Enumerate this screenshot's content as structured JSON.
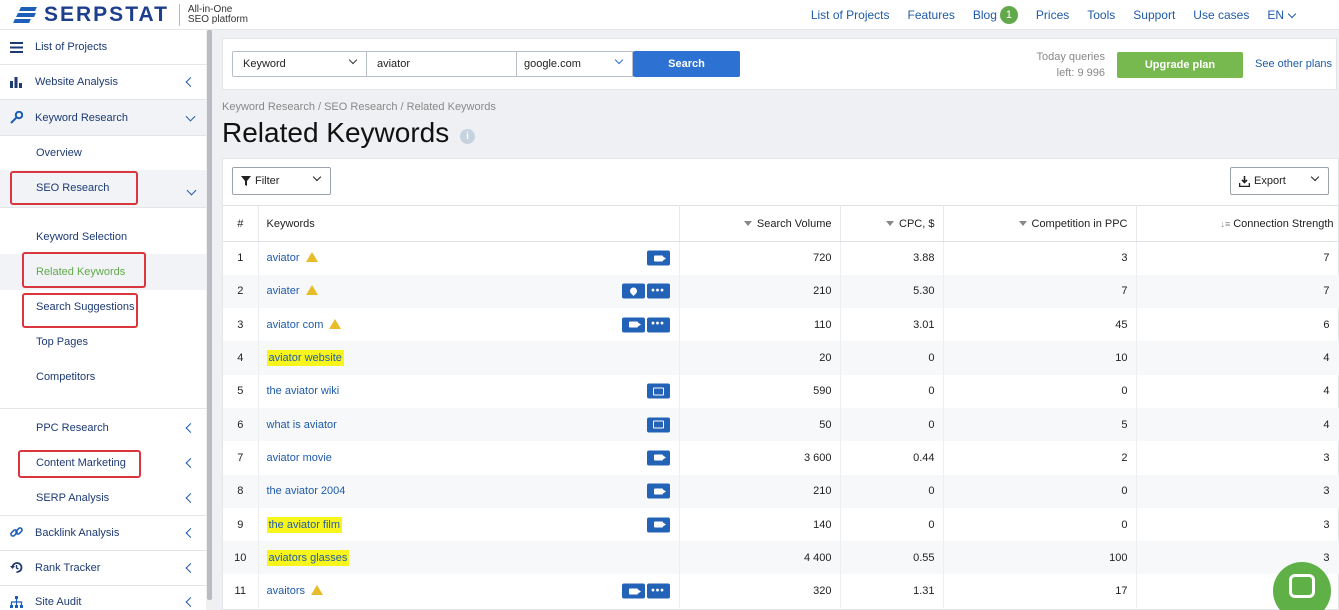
{
  "header": {
    "logo_text": "SERPSTAT",
    "tagline_line1": "All-in-One",
    "tagline_line2": "SEO platform",
    "nav": [
      "List of Projects",
      "Features",
      "Blog",
      "Prices",
      "Tools",
      "Support",
      "Use cases"
    ],
    "blog_badge": "1",
    "lang": "EN"
  },
  "sidebar": {
    "list_projects": "List of Projects",
    "website_analysis": "Website Analysis",
    "keyword_research": "Keyword Research",
    "overview": "Overview",
    "seo_research": "SEO Research",
    "keyword_selection": "Keyword Selection",
    "related_keywords": "Related Keywords",
    "search_suggestions": "Search Suggestions",
    "top_pages": "Top Pages",
    "competitors": "Competitors",
    "ppc_research": "PPC Research",
    "content_marketing": "Content Marketing",
    "serp_analysis": "SERP Analysis",
    "backlink_analysis": "Backlink Analysis",
    "rank_tracker": "Rank Tracker",
    "site_audit": "Site Audit"
  },
  "search": {
    "type": "Keyword",
    "query": "aviator",
    "database": "google.com",
    "button": "Search",
    "queries_line1": "Today queries",
    "queries_line2": "left: 9 996",
    "upgrade": "Upgrade plan",
    "other_plans": "See other plans"
  },
  "breadcrumb": "Keyword Research / SEO Research / Related Keywords",
  "page_title": "Related Keywords",
  "toolbar": {
    "filter": "Filter",
    "export": "Export"
  },
  "table": {
    "headers": {
      "idx": "#",
      "keyword": "Keywords",
      "volume": "Search Volume",
      "cpc": "CPC, $",
      "competition": "Competition in PPC",
      "strength": "Connection Strength"
    },
    "rows": [
      {
        "n": "1",
        "kw": "aviator",
        "warn": true,
        "hl": false,
        "feats": [
          "video"
        ],
        "vol": "720",
        "cpc": "3.88",
        "comp": "3",
        "str": "7"
      },
      {
        "n": "2",
        "kw": "aviater",
        "warn": true,
        "hl": false,
        "feats": [
          "pin",
          "more"
        ],
        "vol": "210",
        "cpc": "5.30",
        "comp": "7",
        "str": "7"
      },
      {
        "n": "3",
        "kw": "aviator com",
        "warn": true,
        "hl": false,
        "feats": [
          "video",
          "more"
        ],
        "vol": "110",
        "cpc": "3.01",
        "comp": "45",
        "str": "6"
      },
      {
        "n": "4",
        "kw": "aviator website",
        "warn": false,
        "hl": true,
        "feats": [],
        "vol": "20",
        "cpc": "0",
        "comp": "10",
        "str": "4"
      },
      {
        "n": "5",
        "kw": "the aviator wiki",
        "warn": false,
        "hl": false,
        "feats": [
          "image"
        ],
        "vol": "590",
        "cpc": "0",
        "comp": "0",
        "str": "4"
      },
      {
        "n": "6",
        "kw": "what is aviator",
        "warn": false,
        "hl": false,
        "feats": [
          "image"
        ],
        "vol": "50",
        "cpc": "0",
        "comp": "5",
        "str": "4"
      },
      {
        "n": "7",
        "kw": "aviator movie",
        "warn": false,
        "hl": false,
        "feats": [
          "video"
        ],
        "vol": "3 600",
        "cpc": "0.44",
        "comp": "2",
        "str": "3"
      },
      {
        "n": "8",
        "kw": "the aviator 2004",
        "warn": false,
        "hl": false,
        "feats": [
          "video"
        ],
        "vol": "210",
        "cpc": "0",
        "comp": "0",
        "str": "3"
      },
      {
        "n": "9",
        "kw": "the aviator film",
        "warn": false,
        "hl": true,
        "feats": [
          "video"
        ],
        "vol": "140",
        "cpc": "0",
        "comp": "0",
        "str": "3"
      },
      {
        "n": "10",
        "kw": "aviators glasses",
        "warn": false,
        "hl": true,
        "feats": [],
        "vol": "4 400",
        "cpc": "0.55",
        "comp": "100",
        "str": "3"
      },
      {
        "n": "11",
        "kw": "avaitors",
        "warn": true,
        "hl": false,
        "feats": [
          "video",
          "more"
        ],
        "vol": "320",
        "cpc": "1.31",
        "comp": "17",
        "str": ""
      }
    ]
  },
  "colors": {
    "brand": "#1d3e8c",
    "link": "#1f5ba8",
    "search": "#2d72d2",
    "upgrade": "#78b94f",
    "highlight": "#f8f51d",
    "annotation": "#d9363e"
  }
}
